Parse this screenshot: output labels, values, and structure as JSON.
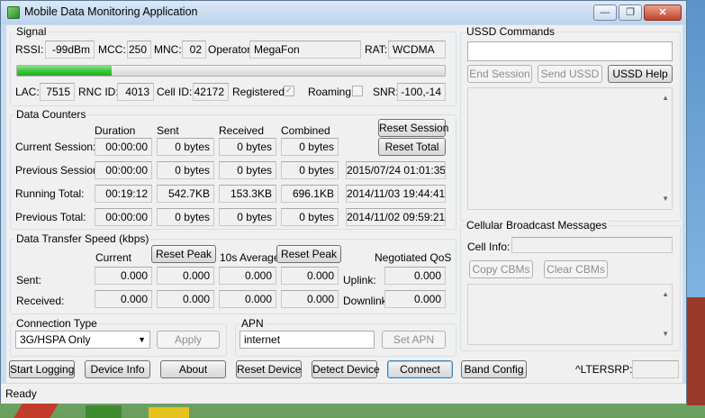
{
  "window": {
    "title": "Mobile Data Monitoring Application",
    "min_label": "—",
    "max_label": "❐",
    "close_label": "✕"
  },
  "signal": {
    "group_label": "Signal",
    "rssi_label": "RSSI:",
    "rssi": "-99dBm",
    "mcc_label": "MCC:",
    "mcc": "250",
    "mnc_label": "MNC:",
    "mnc": "02",
    "operator_label": "Operator:",
    "operator": "MegaFon",
    "rat_label": "RAT:",
    "rat": "WCDMA",
    "signal_bar_fraction": 0.22,
    "lac_label": "LAC:",
    "lac": "7515",
    "rnc_label": "RNC ID:",
    "rnc": "4013",
    "cell_label": "Cell ID:",
    "cell": "42172",
    "registered_label": "Registered:",
    "registered_checked": true,
    "roaming_label": "Roaming:",
    "roaming_checked": false,
    "snr_label": "SNR:",
    "snr": "-100,-14"
  },
  "counters": {
    "group_label": "Data Counters",
    "headers": [
      "Duration",
      "Sent",
      "Received",
      "Combined"
    ],
    "reset_session_label": "Reset Session",
    "reset_total_label": "Reset Total",
    "rows": [
      {
        "label": "Current Session:",
        "duration": "00:00:00",
        "sent": "0 bytes",
        "received": "0 bytes",
        "combined": "0 bytes",
        "date": ""
      },
      {
        "label": "Previous Session:",
        "duration": "00:00:00",
        "sent": "0 bytes",
        "received": "0 bytes",
        "combined": "0 bytes",
        "date": "2015/07/24 01:01:35"
      },
      {
        "label": "Running Total:",
        "duration": "00:19:12",
        "sent": "542.7KB",
        "received": "153.3KB",
        "combined": "696.1KB",
        "date": "2014/11/03 19:44:41"
      },
      {
        "label": "Previous Total:",
        "duration": "00:00:00",
        "sent": "0 bytes",
        "received": "0 bytes",
        "combined": "0 bytes",
        "date": "2014/11/02 09:59:21"
      }
    ]
  },
  "speed": {
    "group_label": "Data Transfer Speed (kbps)",
    "current_label": "Current",
    "reset_peak_label": "Reset Peak",
    "avg_label": "10s Average",
    "qos_label": "Negotiated QoS",
    "sent_label": "Sent:",
    "received_label": "Received:",
    "uplink_label": "Uplink:",
    "downlink_label": "Downlink:",
    "sent": [
      "0.000",
      "0.000",
      "0.000",
      "0.000"
    ],
    "received": [
      "0.000",
      "0.000",
      "0.000",
      "0.000"
    ],
    "uplink": "0.000",
    "downlink": "0.000"
  },
  "connection": {
    "group_label": "Connection Type",
    "selected": "3G/HSPA Only",
    "apply_label": "Apply"
  },
  "apn": {
    "group_label": "APN",
    "value": "internet",
    "set_label": "Set APN"
  },
  "ussd": {
    "group_label": "USSD Commands",
    "input_value": "",
    "end_label": "End Session",
    "send_label": "Send USSD",
    "help_label": "USSD Help"
  },
  "cbm": {
    "group_label": "Cellular Broadcast Messages",
    "cell_info_label": "Cell Info:",
    "cell_info": "",
    "copy_label": "Copy CBMs",
    "clear_label": "Clear CBMs"
  },
  "bottom": {
    "start_logging": "Start Logging",
    "device_info": "Device Info",
    "about": "About",
    "reset_device": "Reset Device",
    "detect_device": "Detect Device",
    "connect": "Connect",
    "band_config": "Band Config",
    "lterssp_label": "^LTERSRP:",
    "lterssp_value": ""
  },
  "status": {
    "text": "Ready"
  },
  "colors": {
    "signal_bar": "#3cc83c",
    "window_frame": "#c9dcef",
    "close_button": "#c4432b"
  }
}
